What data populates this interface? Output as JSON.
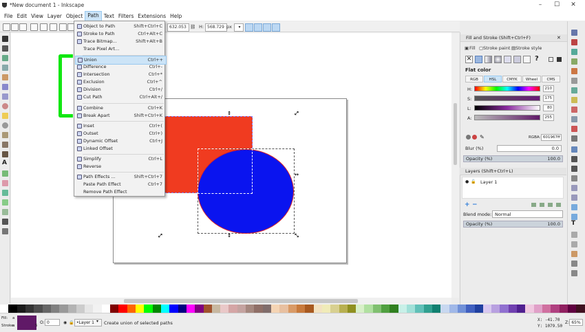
{
  "window": {
    "title": "*New document 1 - Inkscape",
    "controls": [
      "–",
      "☐",
      "✕"
    ]
  },
  "menubar": {
    "items": [
      "File",
      "Edit",
      "View",
      "Layer",
      "Object",
      "Path",
      "Text",
      "Filters",
      "Extensions",
      "Help"
    ],
    "active": "Path"
  },
  "toolbar": {
    "x_value": "632.053",
    "w_label": "H:",
    "h_value": "568.729",
    "unit": "px"
  },
  "path_menu": {
    "items": [
      {
        "label": "Object to Path",
        "shortcut": "Shift+Ctrl+C"
      },
      {
        "label": "Stroke to Path",
        "shortcut": "Ctrl+Alt+C"
      },
      {
        "label": "Trace Bitmap...",
        "shortcut": "Shift+Alt+B"
      },
      {
        "label": "Trace Pixel Art...",
        "shortcut": ""
      },
      {
        "label": "Union",
        "shortcut": "Ctrl++"
      },
      {
        "label": "Difference",
        "shortcut": "Ctrl+-"
      },
      {
        "label": "Intersection",
        "shortcut": "Ctrl+*"
      },
      {
        "label": "Exclusion",
        "shortcut": "Ctrl+^"
      },
      {
        "label": "Division",
        "shortcut": "Ctrl+/"
      },
      {
        "label": "Cut Path",
        "shortcut": "Ctrl+Alt+/"
      },
      {
        "label": "Combine",
        "shortcut": "Ctrl+K"
      },
      {
        "label": "Break Apart",
        "shortcut": "Shift+Ctrl+K"
      },
      {
        "label": "Inset",
        "shortcut": "Ctrl+("
      },
      {
        "label": "Outset",
        "shortcut": "Ctrl+)"
      },
      {
        "label": "Dynamic Offset",
        "shortcut": "Ctrl+J"
      },
      {
        "label": "Linked Offset",
        "shortcut": ""
      },
      {
        "label": "Simplify",
        "shortcut": "Ctrl+L"
      },
      {
        "label": "Reverse",
        "shortcut": ""
      },
      {
        "label": "Path Effects ...",
        "shortcut": "Shift+Ctrl+7"
      },
      {
        "label": "Paste Path Effect",
        "shortcut": "Ctrl+7"
      },
      {
        "label": "Remove Path Effect",
        "shortcut": ""
      }
    ],
    "highlighted": "Union"
  },
  "fill_stroke": {
    "title": "Fill and Stroke (Shift+Ctrl+F)",
    "tabs": [
      "Fill",
      "Stroke paint",
      "Stroke style"
    ],
    "flat_color_label": "Flat color",
    "modes": [
      "RGB",
      "HSL",
      "CMYK",
      "Wheel",
      "CMS"
    ],
    "active_mode": "HSL",
    "sliders": [
      {
        "label": "H:",
        "value": "210"
      },
      {
        "label": "S:",
        "value": "175"
      },
      {
        "label": "L:",
        "value": "80"
      },
      {
        "label": "A:",
        "value": "255"
      }
    ],
    "rgba_label": "RGBA:",
    "rgba_value": "601967ff",
    "blur_label": "Blur (%)",
    "blur_value": "0.0",
    "opacity_label": "Opacity (%)",
    "opacity_value": "100.0"
  },
  "layers": {
    "title": "Layers (Shift+Ctrl+L)",
    "layer_name": "Layer 1",
    "blend_label": "Blend mode:",
    "blend_value": "Normal",
    "opacity_label": "Opacity (%)",
    "opacity_value": "100.0"
  },
  "statusbar": {
    "fill_label": "Fill:",
    "stroke_label": "Stroke:",
    "fill_value": "a",
    "stroke_value": "a",
    "stroke_width": "5",
    "opacity_label": "O:",
    "opacity_value": "0",
    "layer": "•Layer 1",
    "message": "Create union of selected paths",
    "x_coord": "X: -41.70",
    "y_coord": "Y: 1079.50",
    "zoom_label": "Z:",
    "zoom": "65%"
  },
  "colors": {
    "rect": "#f03b20",
    "circle": "#0a14ef",
    "bracket": "#11e711",
    "highlight": "#cce4f7",
    "fill_swatch": "#601967"
  }
}
